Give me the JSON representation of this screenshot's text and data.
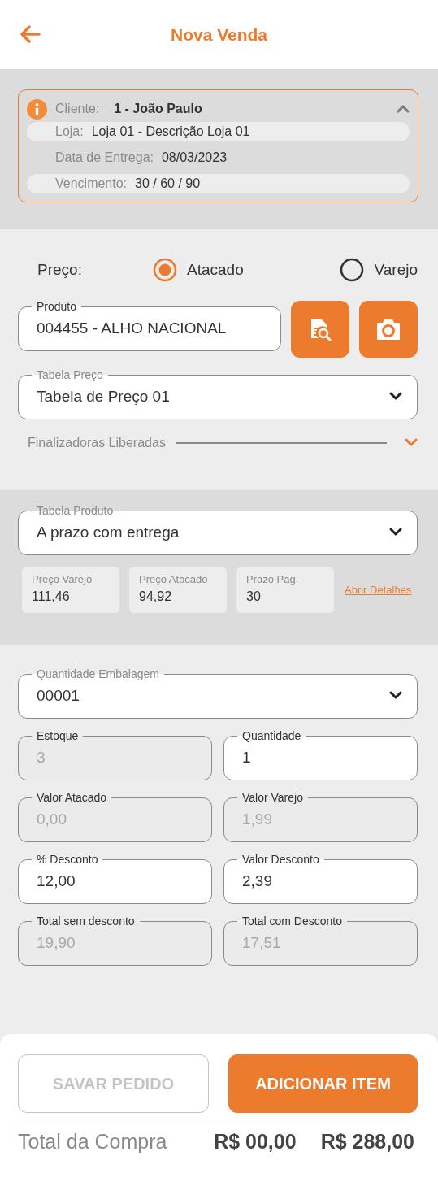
{
  "header": {
    "title": "Nova Venda"
  },
  "client_card": {
    "expanded": true,
    "client_label": "Cliente:",
    "client_value": "1 - João Paulo",
    "rows": [
      {
        "label": "Loja:",
        "value": "Loja 01 - Descrição Loja 01"
      },
      {
        "label": "Data de Entrega:",
        "value": "08/03/2023"
      },
      {
        "label": "Vencimento:",
        "value": "30 / 60 / 90"
      }
    ]
  },
  "price_type": {
    "label": "Preço:",
    "options": [
      {
        "label": "Atacado",
        "selected": true
      },
      {
        "label": "Varejo",
        "selected": false
      }
    ]
  },
  "product_field": {
    "label": "Produto",
    "value": "004455 - ALHO NACIONAL"
  },
  "price_table_field": {
    "kind": "select",
    "label": "Tabela Preço",
    "value": "Tabela de Preço 01"
  },
  "finalizadoras": {
    "label": "Finalizadoras Liberadas",
    "expanded": false
  },
  "product_table_field": {
    "kind": "select",
    "label": "Tabela Produto",
    "value": "A prazo com entrega"
  },
  "summary_chips": [
    {
      "label": "Preço Varejo",
      "value": "111,46"
    },
    {
      "label": "Preço Atacado",
      "value": "94,92"
    },
    {
      "label": "Prazo Pag.",
      "value": "30"
    }
  ],
  "details_link": "Abrir Detalhes",
  "package_field": {
    "kind": "select",
    "label": "Quantidade Embalagem",
    "value": "00001"
  },
  "quantity_fields": [
    {
      "label": "Estoque",
      "value": "3",
      "disabled": true
    },
    {
      "label": "Quantidade",
      "value": "1",
      "disabled": false
    },
    {
      "label": "Valor Atacado",
      "value": "0,00",
      "disabled": true
    },
    {
      "label": "Valor Varejo",
      "value": "1,99",
      "disabled": true
    },
    {
      "label": "% Desconto",
      "value": "12,00",
      "disabled": false
    },
    {
      "label": "Valor Desconto",
      "value": "2,39",
      "disabled": false
    },
    {
      "label": "Total sem desconto",
      "value": "19,90",
      "disabled": true
    },
    {
      "label": "Total com Desconto",
      "value": "17,51",
      "disabled": true
    }
  ],
  "buttons": [
    {
      "label": "SAVAR PEDIDO",
      "disabled": true
    },
    {
      "label": "ADICIONAR ITEM",
      "disabled": false
    }
  ],
  "total": {
    "label": "Total da Compra",
    "values": [
      "R$ 00,00",
      "R$ 288,00"
    ]
  }
}
